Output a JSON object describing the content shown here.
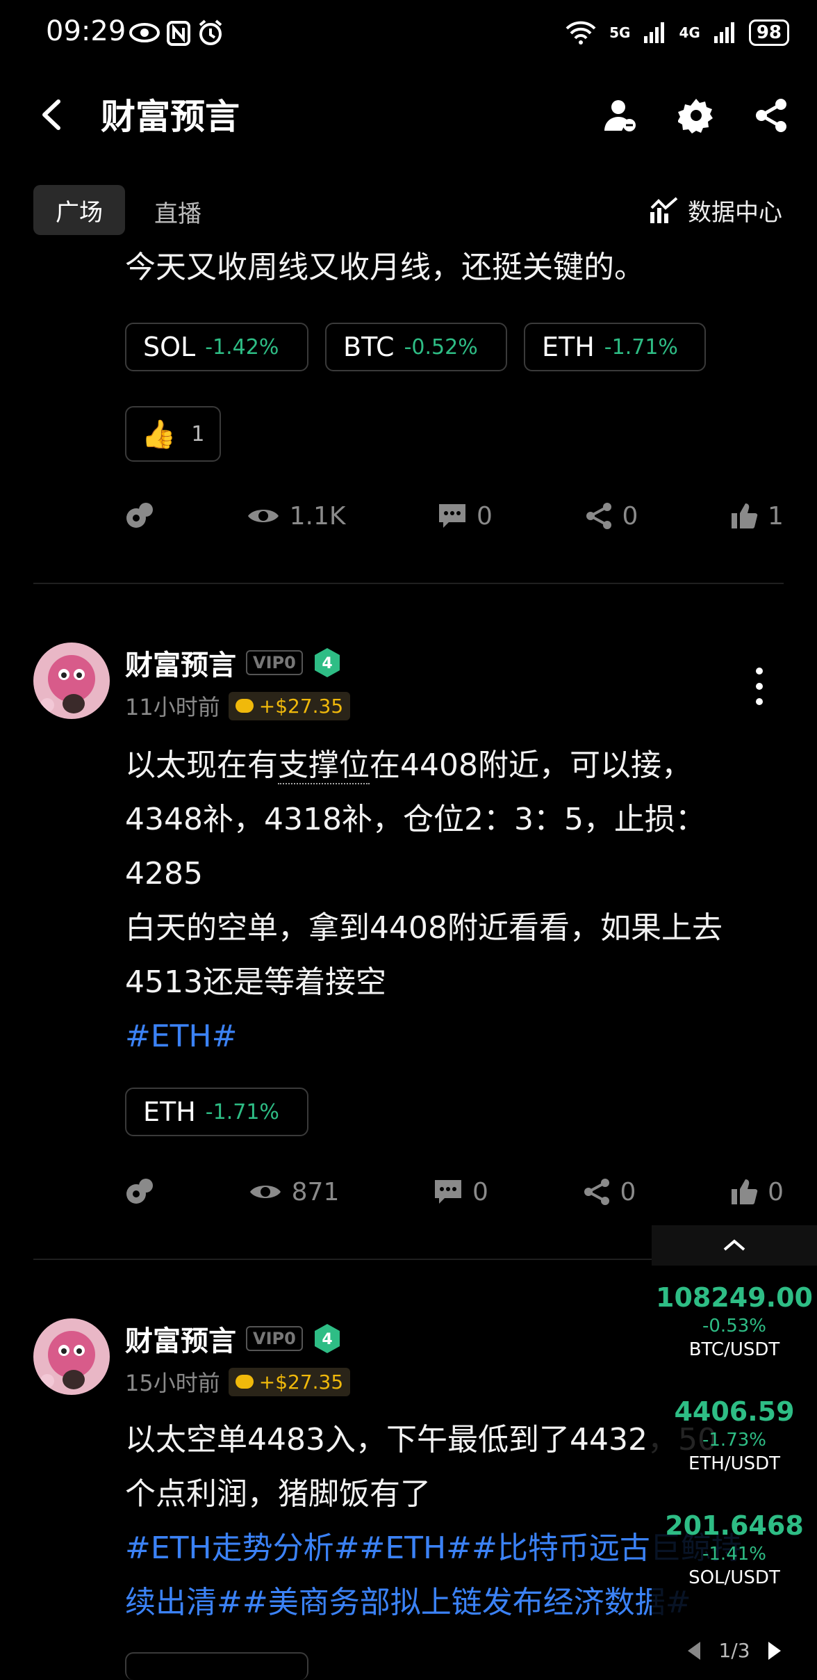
{
  "status_bar": {
    "time": "09:29",
    "battery": "98",
    "net1": "5G",
    "net2": "4G"
  },
  "header": {
    "title": "财富预言"
  },
  "tabs": {
    "active": "广场",
    "other": "直播",
    "data_center": "数据中心"
  },
  "post0": {
    "text": "今天又收周线又收月线，还挺关键的。",
    "chips": [
      {
        "sym": "SOL",
        "pct": "-1.42%"
      },
      {
        "sym": "BTC",
        "pct": "-0.52%"
      },
      {
        "sym": "ETH",
        "pct": "-1.71%"
      }
    ],
    "reaction_count": "1",
    "views": "1.1K",
    "comments": "0",
    "shares": "0",
    "likes": "1"
  },
  "post1": {
    "author": "财富预言",
    "vip": "VIP0",
    "level": "4",
    "time": "11小时前",
    "earn": "+$27.35",
    "line1a": "以太现在有",
    "line1b": "支撑位",
    "line1c": "在4408附近，可以接，",
    "line2": "4348补，4318补，仓位2：3：5，止损：",
    "line3": "4285",
    "line4": "白天的空单，拿到4408附近看看，如果上去",
    "line5": "4513还是等着接空",
    "hashtag": "#ETH#",
    "chip": {
      "sym": "ETH",
      "pct": "-1.71%"
    },
    "views": "871",
    "comments": "0",
    "shares": "0",
    "likes": "0"
  },
  "post2": {
    "author": "财富预言",
    "vip": "VIP0",
    "level": "4",
    "time": "15小时前",
    "earn": "+$27.35",
    "line1": "以太空单4483入，下午最低到了4432，50",
    "line2": "个点利润，猪脚饭有了",
    "tags1": "#ETH走势分析##ETH##比特币远古巨鲸持",
    "tags2": "续出清##美商务部拟上链发布经济数据#"
  },
  "ticker": {
    "items": [
      {
        "price": "108249.00",
        "change": "-0.53%",
        "pair": "BTC/USDT"
      },
      {
        "price": "4406.59",
        "change": "-1.73%",
        "pair": "ETH/USDT"
      },
      {
        "price": "201.6468",
        "change": "-1.41%",
        "pair": "SOL/USDT"
      }
    ],
    "page": "1/3"
  }
}
